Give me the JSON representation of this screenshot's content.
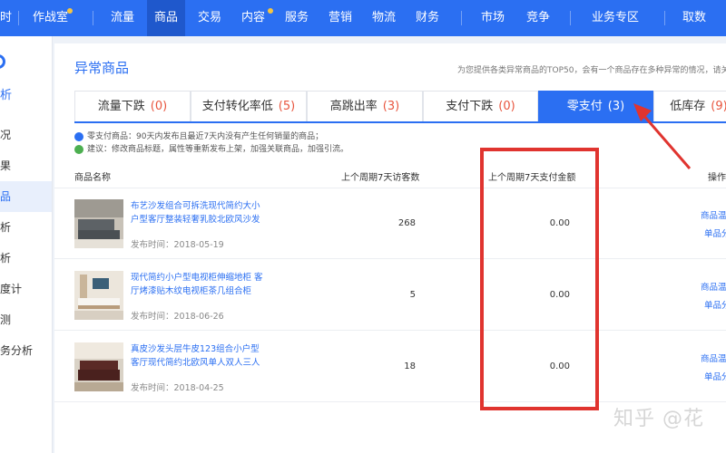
{
  "topnav": {
    "items": [
      "时",
      "作战室",
      "流量",
      "商品",
      "交易",
      "内容",
      "服务",
      "营销",
      "物流",
      "财务",
      "市场",
      "竞争",
      "业务专区",
      "取数"
    ],
    "active_index": 3,
    "dots": [
      1,
      5
    ]
  },
  "sidebar": {
    "title": "析",
    "items": [
      "况",
      "果",
      "品",
      "析",
      "析",
      "度计",
      "测",
      "务分析"
    ],
    "active_index": 2
  },
  "page": {
    "title": "异常商品",
    "desc": "为您提供各类异常商品的TOP50，会有一个商品存在多种异常的情况，请关"
  },
  "tabs": [
    {
      "label": "流量下跌",
      "count": "(0)"
    },
    {
      "label": "支付转化率低",
      "count": "(5)"
    },
    {
      "label": "高跳出率",
      "count": "(3)"
    },
    {
      "label": "支付下跌",
      "count": "(0)"
    },
    {
      "label": "零支付",
      "count": "(3)"
    },
    {
      "label": "低库存",
      "count": "(9)"
    }
  ],
  "active_tab": 4,
  "tips": {
    "definition": "零支付商品：90天内发布且最近7天内没有产生任何销量的商品；",
    "suggestion": "建议：修改商品标题，属性等重新发布上架，加强关联商品，加强引流。"
  },
  "table": {
    "headers": [
      "商品名称",
      "上个周期7天访客数",
      "上个周期7天支付金额",
      "操作"
    ],
    "rows": [
      {
        "name": "布艺沙发组合可拆洗现代简约大小户型客厅整装轻奢乳胶北欧风沙发",
        "date": "发布时间：2018-05-19",
        "visitors": "268",
        "amount": "0.00",
        "op1": "商品温",
        "op2": "单品分"
      },
      {
        "name": "现代简约小户型电视柜伸缩地柜 客厅烤漆贴木纹电视柜茶几组合柜",
        "date": "发布时间：2018-06-26",
        "visitors": "5",
        "amount": "0.00",
        "op1": "商品温",
        "op2": "单品分"
      },
      {
        "name": "真皮沙发头层牛皮123组合小户型客厅现代简约北欧风单人双人三人",
        "date": "发布时间：2018-04-25",
        "visitors": "18",
        "amount": "0.00",
        "op1": "商品温",
        "op2": "单品分"
      }
    ]
  },
  "watermark": "知乎 @花",
  "colors": {
    "brand": "#2b6ff2",
    "nav_active": "#1f58cc",
    "count": "#e8553e",
    "highlight": "#e0342f",
    "tip_info": "#2b6ff2",
    "tip_ok": "#4caf50"
  }
}
